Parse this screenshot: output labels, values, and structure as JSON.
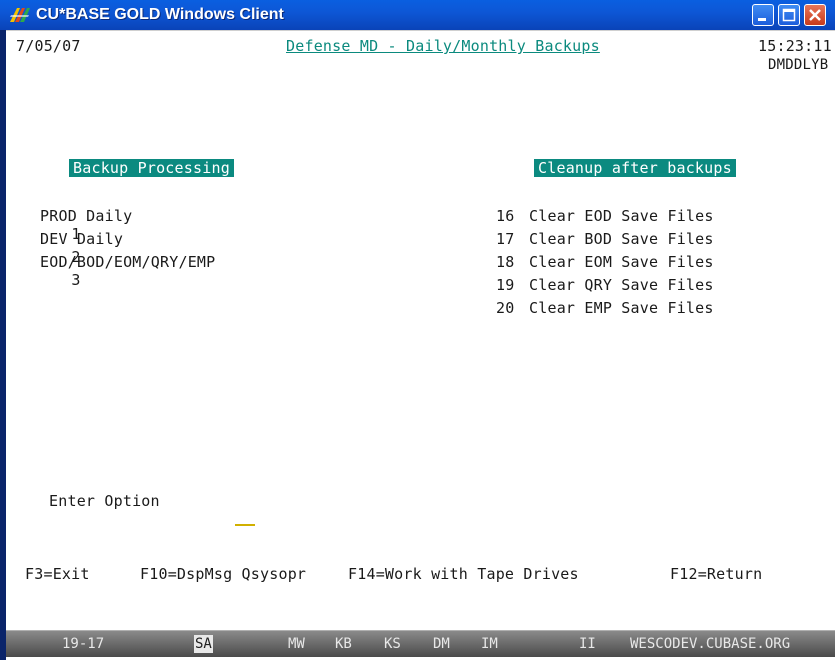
{
  "window": {
    "title": "CU*BASE GOLD Windows Client"
  },
  "screen": {
    "date": "7/05/07",
    "heading": "Defense MD - Daily/Monthly Backups",
    "time": "15:23:11",
    "program_id": "DMDDLYB",
    "left_section_title": "Backup Processing",
    "right_section_title": "Cleanup after backups",
    "left_options": [
      {
        "num": "1",
        "label": "PROD Daily"
      },
      {
        "num": "2",
        "label": "DEV Daily"
      },
      {
        "num": "3",
        "label": "EOD/BOD/EOM/QRY/EMP"
      }
    ],
    "right_options": [
      {
        "num": "16",
        "label": "Clear EOD Save Files"
      },
      {
        "num": "17",
        "label": "Clear BOD Save Files"
      },
      {
        "num": "18",
        "label": "Clear EOM Save Files"
      },
      {
        "num": "19",
        "label": "Clear QRY Save Files"
      },
      {
        "num": "20",
        "label": "Clear EMP Save Files"
      }
    ],
    "option_prompt": "Enter Option",
    "option_value": ""
  },
  "function_keys": [
    {
      "label": "F3=Exit"
    },
    {
      "label": "F10=DspMsg Qsysopr"
    },
    {
      "label": "F14=Work with Tape Drives"
    },
    {
      "label": "F12=Return"
    }
  ],
  "status_bar": {
    "cursor_pos": "19-17",
    "indicators": [
      "SA",
      "MW",
      "KB",
      "KS",
      "DM",
      "IM",
      "II"
    ],
    "host": "WESCODEV.CUBASE.ORG"
  },
  "colors": {
    "title_bar": "#0a5fe0",
    "header_box": "#0b8a80",
    "link_text": "#0b8a7e",
    "input_underline": "#d1b000",
    "close_button": "#c73a1c"
  },
  "icons": {
    "app": "cubase-logo-icon",
    "minimize": "minimize-icon",
    "maximize": "maximize-icon",
    "close": "close-icon"
  }
}
